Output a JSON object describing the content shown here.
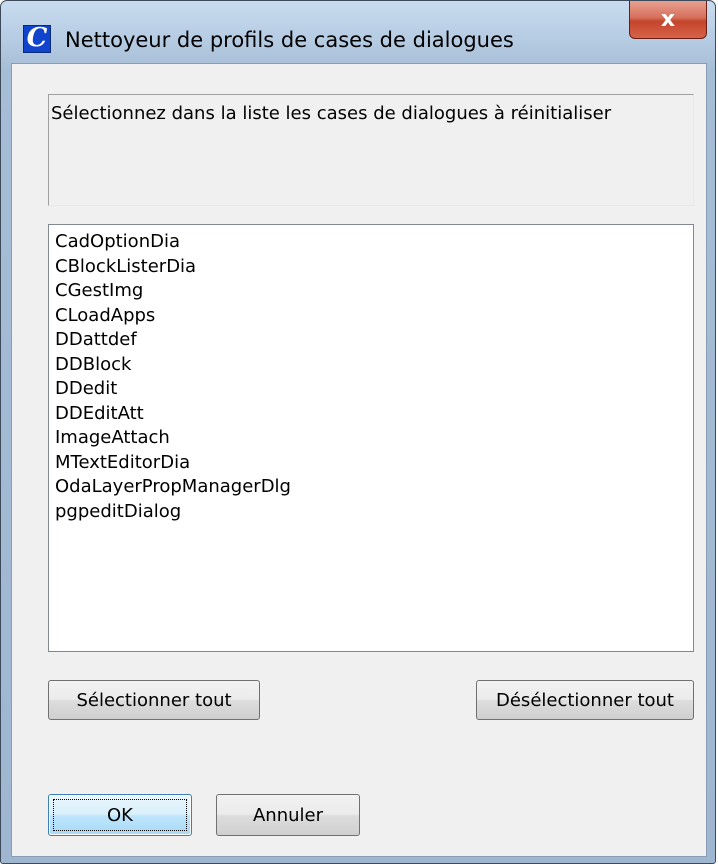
{
  "window": {
    "title": "Nettoyeur de profils de cases de dialogues",
    "app_icon_glyph": "C",
    "close_glyph": "x"
  },
  "message": {
    "text": "Sélectionnez dans la liste les cases de dialogues à réinitialiser"
  },
  "dialog_list": {
    "items": [
      "CadOptionDia",
      "CBlockListerDia",
      "CGestImg",
      "CLoadApps",
      "DDattdef",
      "DDBlock",
      "DDedit",
      "DDEditAtt",
      "ImageAttach",
      "MTextEditorDia",
      "OdaLayerPropManagerDlg",
      "pgpeditDialog"
    ]
  },
  "buttons": {
    "select_all": "Sélectionner tout",
    "deselect_all": "Désélectionner tout",
    "ok": "OK",
    "cancel": "Annuler"
  },
  "colors": {
    "title_frame": "#b5cbe2",
    "close_button": "#c4452b",
    "app_icon": "#1144cc",
    "dialog_face": "#f0f0f0",
    "default_button": "#bee6fd"
  }
}
